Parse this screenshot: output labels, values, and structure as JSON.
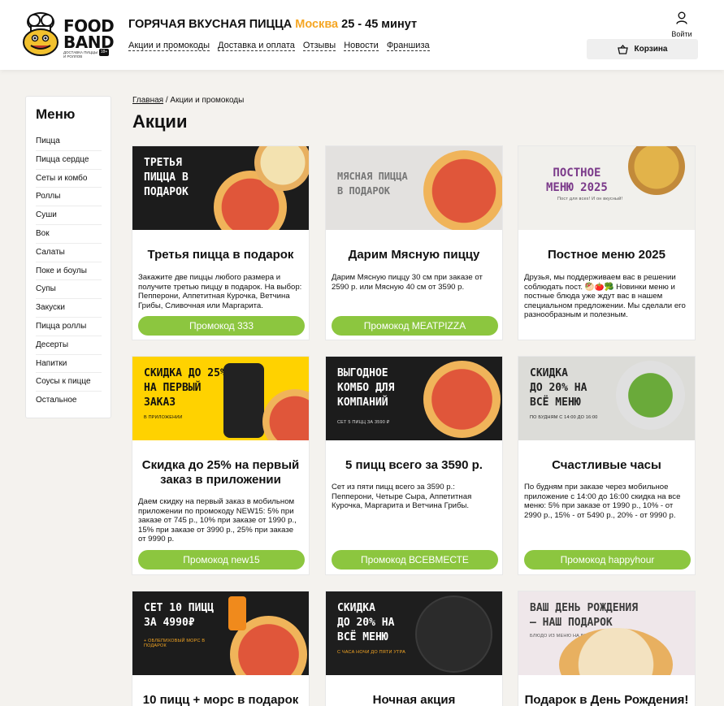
{
  "header": {
    "logo": {
      "line1": "FOOD",
      "line2": "BAND",
      "sub": "ДОСТАВКА ПИЦЦЫ И РОЛЛОВ",
      "badge": "18+"
    },
    "headline": "ГОРЯЧАЯ ВКУСНАЯ ПИЦЦА",
    "city": "Москва",
    "time": "25 - 45 минут",
    "nav": [
      "Акции и промокоды",
      "Доставка и оплата",
      "Отзывы",
      "Новости",
      "Франшиза"
    ],
    "login_label": "Войти",
    "cart_label": "Корзина"
  },
  "sidebar": {
    "title": "Меню",
    "items": [
      "Пицца",
      "Пицца сердце",
      "Сеты и комбо",
      "Роллы",
      "Суши",
      "Вок",
      "Салаты",
      "Поке и боулы",
      "Супы",
      "Закуски",
      "Пицца роллы",
      "Десерты",
      "Напитки",
      "Соусы к пицце",
      "Остальное"
    ]
  },
  "breadcrumb": {
    "home": "Главная",
    "separator": "/",
    "current": "Акции и промокоды"
  },
  "page_title": "Акции",
  "cards": [
    {
      "banner": "ТРЕТЬЯ\nПИЦЦА В\nПОДАРОК",
      "banner_sub": "",
      "title": "Третья пицца в подарок",
      "desc": "Закажите две пиццы любого размера и получите третью пиццу в подарок. На выбор: Пепперони, Аппетитная Курочка, Ветчина Грибы, Сливочная или Маргарита.",
      "promo": "Промокод 333"
    },
    {
      "banner": "МЯСНАЯ ПИЦЦА\nВ ПОДАРОК",
      "banner_sub": "",
      "title": "Дарим Мясную пиццу",
      "desc": "Дарим Мясную пиццу 30 см при заказе от 2590 р. или Мясную 40 см от 3590 р.",
      "promo": "Промокод MEATPIZZA"
    },
    {
      "banner": "ПОСТНОЕ\nМЕНЮ 2025",
      "banner_sub": "Пост для всех! И он вкусный!",
      "title": "Постное меню 2025",
      "desc": "Друзья, мы поддерживаем вас в решении соблюдать пост. 🥙🍅🥦 Новинки меню и постные блюда уже ждут вас в нашем специальном предложении. Мы сделали его разнообразным и полезным.",
      "promo": ""
    },
    {
      "banner": "СКИДКА ДО 25%\nНА ПЕРВЫЙ\nЗАКАЗ",
      "banner_sub": "В ПРИЛОЖЕНИИ",
      "title": "Скидка до 25% на первый заказ в приложении",
      "desc": "Даем скидку на первый заказ в мобильном приложении по промокоду NEW15: 5% при заказе от 745 р., 10% при заказе от 1990 р., 15% при заказе от 3990 р., 25% при заказе от 9990 р.",
      "promo": "Промокод new15"
    },
    {
      "banner": "ВЫГОДНОЕ\nКОМБО ДЛЯ\nКОМПАНИЙ",
      "banner_sub": "СЕТ 5 ПИЦЦ ЗА 3590 ₽",
      "title": "5 пицц всего за 3590 р.",
      "desc": "Сет из пяти пицц всего за 3590 р.: Пепперони, Четыре Сыра, Аппетитная Курочка, Маргарита и Ветчина Грибы.",
      "promo": "Промокод ВСЕВМЕСТЕ"
    },
    {
      "banner": "СКИДКА\nДО 20% НА\nВСЁ МЕНЮ",
      "banner_sub": "ПО БУДНЯМ С 14:00 ДО 16:00",
      "title": "Счастливые часы",
      "desc": "По будням при заказе через мобильное приложение с 14:00 до 16:00 скидка на все меню: 5% при заказе от 1990 р., 10% - от 2990 р., 15% - от 5490 р., 20% - от 9990 р.",
      "promo": "Промокод happyhour"
    },
    {
      "banner": "СЕТ 10 ПИЦЦ\nЗА 4990₽",
      "banner_sub": "+ ОБЛЕПИХОВЫЙ МОРС В ПОДАРОК",
      "title": "10 пицц + морс в подарок",
      "desc": "",
      "promo": ""
    },
    {
      "banner": "СКИДКА\nДО 20% НА\nВСЁ МЕНЮ",
      "banner_sub": "С ЧАСА НОЧИ ДО ПЯТИ УТРА",
      "title": "Ночная акция",
      "desc": "",
      "promo": ""
    },
    {
      "banner": "ВАШ ДЕНЬ РОЖДЕНИЯ\n– НАШ ПОДАРОК",
      "banner_sub": "БЛЮДО ИЗ МЕНЮ НА ВЫБОР",
      "title": "Подарок в День Рождения!",
      "desc": "",
      "promo": ""
    }
  ],
  "colors": {
    "accent": "#f5a623",
    "promo_button": "#8cc63f",
    "background": "#f4f2ee"
  }
}
